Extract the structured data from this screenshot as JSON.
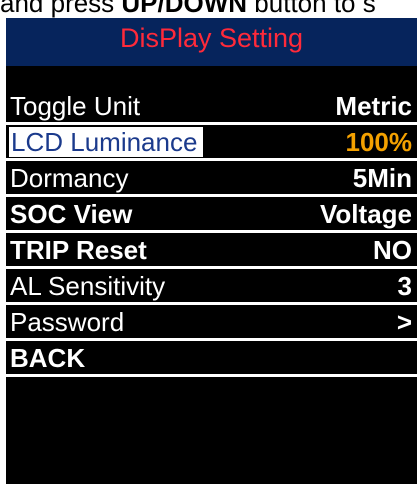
{
  "caption": {
    "text_before": "and press ",
    "bold_text": "UP/DOWN",
    "text_after": " button to s"
  },
  "screen": {
    "title": "DisPlay Setting",
    "colors": {
      "title_bar_bg": "#06245c",
      "title_text": "#ff2a3a",
      "background": "#000000",
      "selected_label_bg": "#ffffff",
      "selected_label_text": "#1b3a8c",
      "selected_value_text": "#f4a100"
    },
    "items": [
      {
        "label": "Toggle Unit",
        "value": "Metric"
      },
      {
        "label": "LCD  Luminance",
        "value": "100%"
      },
      {
        "label": "Dormancy",
        "value": "5Min"
      },
      {
        "label": "SOC View",
        "value": "Voltage"
      },
      {
        "label": "TRIP Reset",
        "value": "NO"
      },
      {
        "label": "AL  Sensitivity",
        "value": "3"
      },
      {
        "label": "Password",
        "value": ">"
      },
      {
        "label": "BACK",
        "value": ""
      }
    ],
    "selected_item": "LCD  Luminance"
  }
}
